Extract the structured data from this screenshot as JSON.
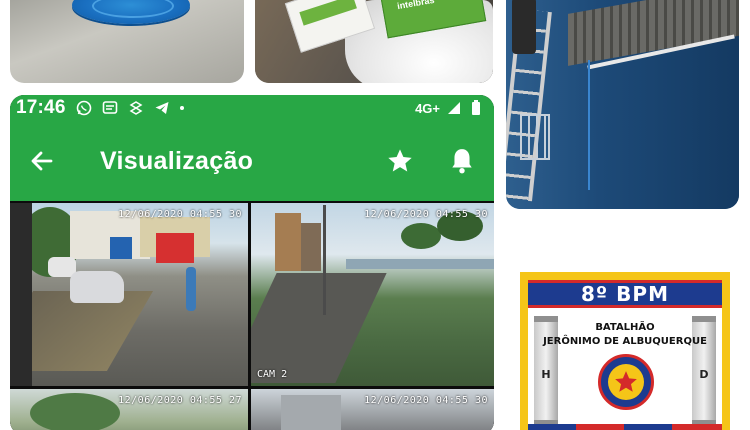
{
  "status_bar": {
    "time": "17:46",
    "network": "4G+",
    "notification_icons": [
      "whatsapp-icon",
      "message-icon",
      "sync-icon",
      "telegram-icon"
    ]
  },
  "app_bar": {
    "title": "Visualização",
    "back_icon": "arrow-left-icon",
    "actions": [
      "star-icon",
      "bell-icon"
    ],
    "color": "#28a745"
  },
  "cameras": [
    {
      "timestamp": "12/06/2020 04:55 30",
      "label": ""
    },
    {
      "timestamp": "12/06/2020 04:55 30",
      "label": "CAM 2"
    },
    {
      "timestamp": "12/06/2020 04:55 27",
      "label": ""
    },
    {
      "timestamp": "12/06/2020 04:55 30",
      "label": ""
    }
  ],
  "badge": {
    "title": "8º BPM",
    "line1": "BATALHÃO",
    "line2": "JERÔNIMO DE ALBUQUERQUE",
    "pillar_left": "H",
    "pillar_right": "D"
  },
  "colors": {
    "accent": "#28a745",
    "badge_blue": "#1d3b8f",
    "badge_red": "#d42a2a",
    "badge_yellow": "#f5c518"
  }
}
